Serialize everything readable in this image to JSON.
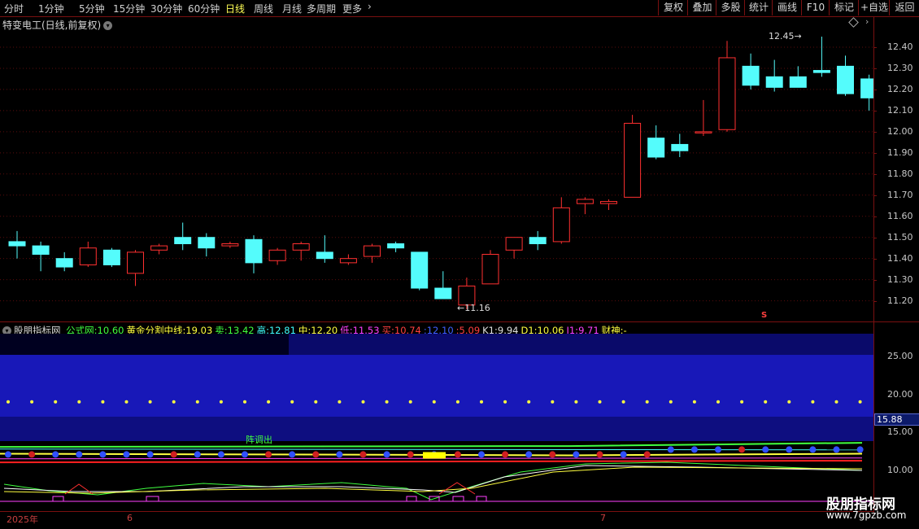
{
  "toolbar": {
    "tabs": [
      "分时",
      "1分钟",
      "5分钟",
      "15分钟",
      "30分钟",
      "60分钟",
      "日线",
      "周线",
      "月线",
      "多周期",
      "更多"
    ],
    "active_tab": "日线",
    "right_buttons": [
      "复权",
      "叠加",
      "多股",
      "统计",
      "画线",
      "F10",
      "标记",
      "+自选",
      "返回"
    ]
  },
  "chart_title": "特变电工(日线,前复权)",
  "main_axis": {
    "ticks": [
      "12.40",
      "12.30",
      "12.20",
      "12.10",
      "12.00",
      "11.90",
      "11.80",
      "11.70",
      "11.60",
      "11.50",
      "11.40",
      "11.30",
      "11.20"
    ]
  },
  "annotations": {
    "high": "12.45",
    "low": "11.16",
    "marker": "S"
  },
  "indicator": {
    "name": "股朋指标网",
    "items": [
      {
        "label": "公式网:",
        "value": "10.60",
        "color": "#40ff40"
      },
      {
        "label": "黄金分割中线:",
        "value": "19.03",
        "color": "#ffff40"
      },
      {
        "label": "卖:",
        "value": "13.42",
        "color": "#40ff40"
      },
      {
        "label": "高:",
        "value": "12.81",
        "color": "#40ffff"
      },
      {
        "label": "中:",
        "value": "12.20",
        "color": "#ffff40"
      },
      {
        "label": "低:",
        "value": "11.53",
        "color": "#ff40ff"
      },
      {
        "label": "买:",
        "value": "10.74",
        "color": "#ff4040"
      },
      {
        "label": ":",
        "value": "12.10",
        "color": "#4060ff"
      },
      {
        "label": ":",
        "value": "5.09",
        "color": "#ff4040"
      },
      {
        "label": "K1:",
        "value": "9.94",
        "color": "#e0e0e0"
      },
      {
        "label": "D1:",
        "value": "10.06",
        "color": "#ffff40"
      },
      {
        "label": "J1:",
        "value": "9.71",
        "color": "#ff40ff"
      },
      {
        "label": "财神:",
        "value": "-",
        "color": "#ffff40"
      }
    ],
    "axis_ticks": [
      "25.00",
      "20.00",
      "15.00",
      "10.00"
    ],
    "current_value": "15.88",
    "signal_text": "阵调出"
  },
  "x_axis": {
    "labels": [
      "2025年",
      "6",
      "7"
    ]
  },
  "watermark": {
    "name": "股朋指标网",
    "url": "www.7gpzb.com"
  },
  "colors": {
    "up": "#ff3030",
    "down": "#54fcfc",
    "frame": "#7a1010"
  },
  "chart_data": {
    "type": "candlestick",
    "ylim": [
      11.15,
      12.45
    ],
    "candles": [
      {
        "o": 11.48,
        "h": 11.53,
        "l": 11.4,
        "c": 11.46
      },
      {
        "o": 11.46,
        "h": 11.48,
        "l": 11.34,
        "c": 11.42
      },
      {
        "o": 11.4,
        "h": 11.43,
        "l": 11.34,
        "c": 11.36
      },
      {
        "o": 11.37,
        "h": 11.48,
        "l": 11.36,
        "c": 11.45
      },
      {
        "o": 11.44,
        "h": 11.45,
        "l": 11.36,
        "c": 11.37
      },
      {
        "o": 11.33,
        "h": 11.44,
        "l": 11.27,
        "c": 11.43
      },
      {
        "o": 11.44,
        "h": 11.47,
        "l": 11.42,
        "c": 11.46
      },
      {
        "o": 11.5,
        "h": 11.57,
        "l": 11.44,
        "c": 11.47
      },
      {
        "o": 11.5,
        "h": 11.52,
        "l": 11.41,
        "c": 11.45
      },
      {
        "o": 11.46,
        "h": 11.48,
        "l": 11.45,
        "c": 11.47
      },
      {
        "o": 11.49,
        "h": 11.51,
        "l": 11.33,
        "c": 11.38
      },
      {
        "o": 11.39,
        "h": 11.45,
        "l": 11.37,
        "c": 11.44
      },
      {
        "o": 11.44,
        "h": 11.48,
        "l": 11.39,
        "c": 11.47
      },
      {
        "o": 11.43,
        "h": 11.51,
        "l": 11.38,
        "c": 11.4
      },
      {
        "o": 11.38,
        "h": 11.42,
        "l": 11.37,
        "c": 11.4
      },
      {
        "o": 11.41,
        "h": 11.47,
        "l": 11.38,
        "c": 11.46
      },
      {
        "o": 11.47,
        "h": 11.48,
        "l": 11.43,
        "c": 11.45
      },
      {
        "o": 11.43,
        "h": 11.43,
        "l": 11.25,
        "c": 11.26
      },
      {
        "o": 11.26,
        "h": 11.34,
        "l": 11.21,
        "c": 11.21
      },
      {
        "o": 11.18,
        "h": 11.31,
        "l": 11.16,
        "c": 11.27
      },
      {
        "o": 11.28,
        "h": 11.44,
        "l": 11.28,
        "c": 11.42
      },
      {
        "o": 11.44,
        "h": 11.5,
        "l": 11.4,
        "c": 11.5
      },
      {
        "o": 11.5,
        "h": 11.53,
        "l": 11.44,
        "c": 11.47
      },
      {
        "o": 11.48,
        "h": 11.69,
        "l": 11.47,
        "c": 11.64
      },
      {
        "o": 11.66,
        "h": 11.69,
        "l": 11.61,
        "c": 11.68
      },
      {
        "o": 11.66,
        "h": 11.68,
        "l": 11.63,
        "c": 11.67
      },
      {
        "o": 11.69,
        "h": 12.08,
        "l": 11.69,
        "c": 12.04
      },
      {
        "o": 11.97,
        "h": 12.03,
        "l": 11.87,
        "c": 11.88
      },
      {
        "o": 11.94,
        "h": 11.99,
        "l": 11.88,
        "c": 11.91
      },
      {
        "o": 12.0,
        "h": 12.15,
        "l": 11.98,
        "c": 12.0
      },
      {
        "o": 12.01,
        "h": 12.43,
        "l": 12.0,
        "c": 12.35
      },
      {
        "o": 12.31,
        "h": 12.37,
        "l": 12.2,
        "c": 12.22
      },
      {
        "o": 12.26,
        "h": 12.34,
        "l": 12.19,
        "c": 12.21
      },
      {
        "o": 12.26,
        "h": 12.31,
        "l": 12.21,
        "c": 12.21
      },
      {
        "o": 12.29,
        "h": 12.45,
        "l": 12.26,
        "c": 12.28
      },
      {
        "o": 12.31,
        "h": 12.36,
        "l": 12.17,
        "c": 12.18
      },
      {
        "o": 12.25,
        "h": 12.27,
        "l": 12.1,
        "c": 12.16
      }
    ]
  }
}
